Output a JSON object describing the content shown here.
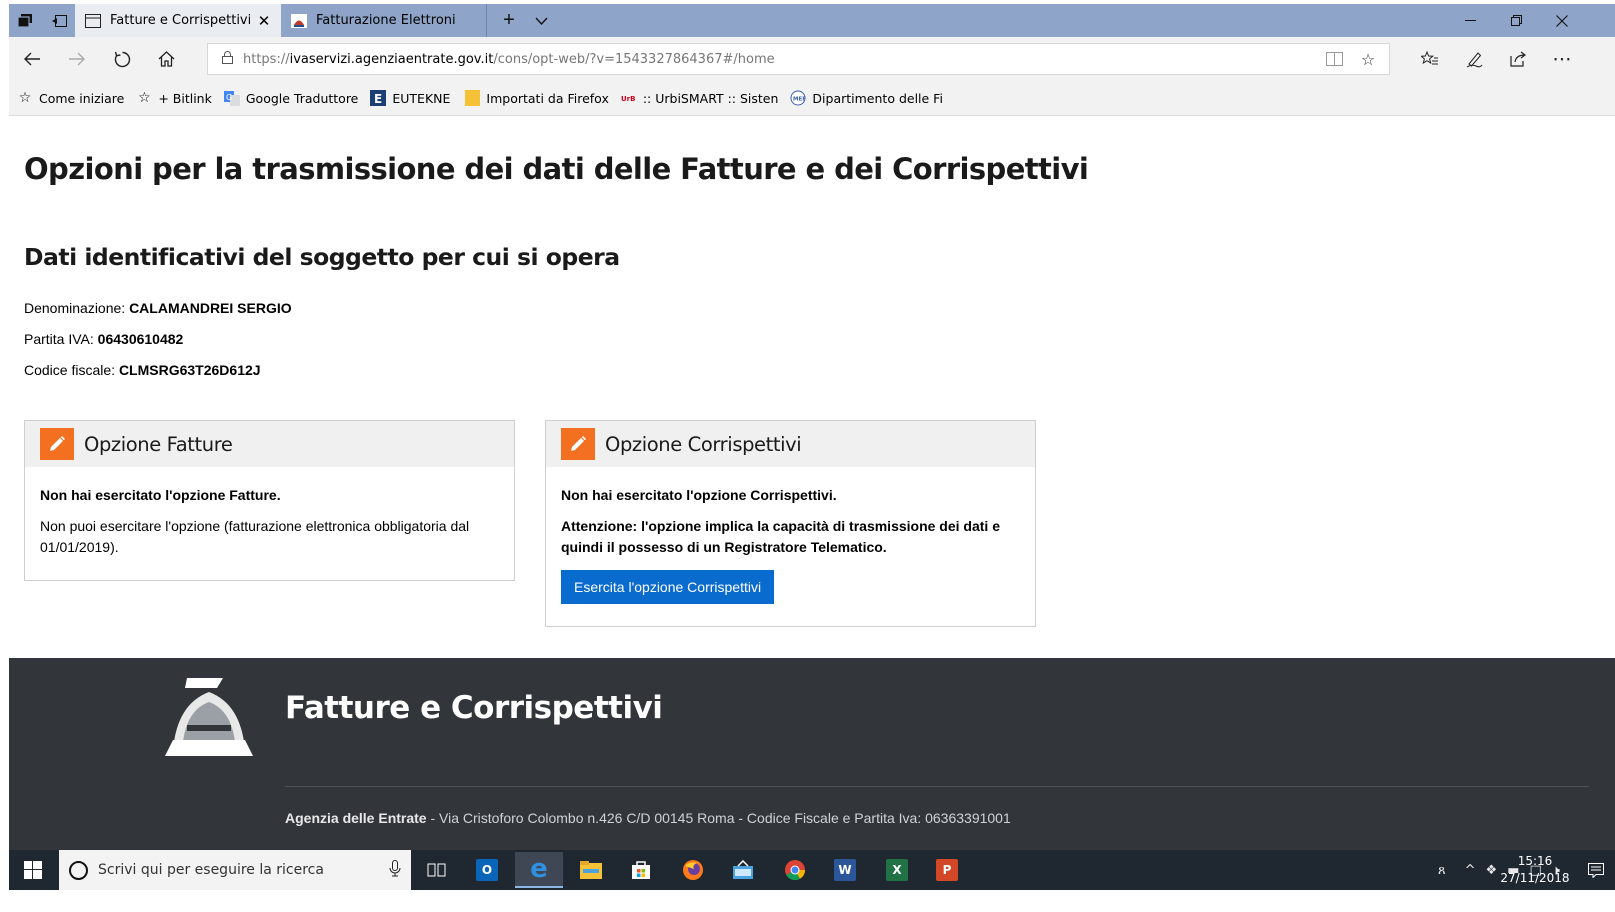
{
  "browser": {
    "tabs": [
      {
        "label": "Fatture e Corrispettivi- (",
        "active": true
      },
      {
        "label": "Fatturazione Elettronica - Es",
        "active": false
      }
    ],
    "new_tab_symbol": "+",
    "url": {
      "protocol": "https://",
      "host": "ivaservizi.agenziaentrate.gov.it",
      "path": "/cons/opt-web/?v=1543327864367#/home"
    },
    "favorites": [
      {
        "label": "Come iniziare",
        "icon": "star-icon"
      },
      {
        "label": "+ Bitlink",
        "icon": "star-icon"
      },
      {
        "label": "Google Traduttore",
        "icon": "translate-icon"
      },
      {
        "label": "EUTEKNE",
        "icon": "eutekne-icon"
      },
      {
        "label": "Importati da Firefox",
        "icon": "folder-icon"
      },
      {
        "label": ":: UrbiSMART :: Sisten",
        "icon": "urbismart-icon"
      },
      {
        "label": "Dipartimento delle Fi",
        "icon": "mef-icon"
      }
    ]
  },
  "page": {
    "title": "Opzioni per la trasmissione dei dati delle Fatture e dei Corrispettivi",
    "section_title": "Dati identificativi del soggetto per cui si opera",
    "identity": {
      "denominazione_label": "Denominazione:",
      "denominazione_value": "CALAMANDREI SERGIO",
      "partita_iva_label": "Partita IVA:",
      "partita_iva_value": "06430610482",
      "codice_fiscale_label": "Codice fiscale:",
      "codice_fiscale_value": "CLMSRG63T26D612J"
    },
    "cards": {
      "fatture": {
        "title": "Opzione Fatture",
        "status": "Non hai esercitato l'opzione Fatture.",
        "note": "Non puoi esercitare l'opzione (fatturazione elettronica obbligatoria dal 01/01/2019)."
      },
      "corrispettivi": {
        "title": "Opzione Corrispettivi",
        "status": "Non hai esercitato l'opzione Corrispettivi.",
        "warning": "Attenzione: l'opzione implica la capacità di trasmissione dei dati e quindi il possesso di un Registratore Telematico.",
        "button_label": "Esercita l'opzione Corrispettivi"
      }
    },
    "accent_color": "#f2701f",
    "button_color": "#0a6bce"
  },
  "footer": {
    "title": "Fatture e Corrispettivi",
    "agency": "Agenzia delle Entrate",
    "address": " - Via Cristoforo Colombo n.426 C/D 00145 Roma - Codice Fiscale e Partita Iva: 06363391001"
  },
  "taskbar": {
    "search_placeholder": "Scrivi qui per eseguire la ricerca",
    "time": "15:16",
    "date": "27/11/2018"
  }
}
